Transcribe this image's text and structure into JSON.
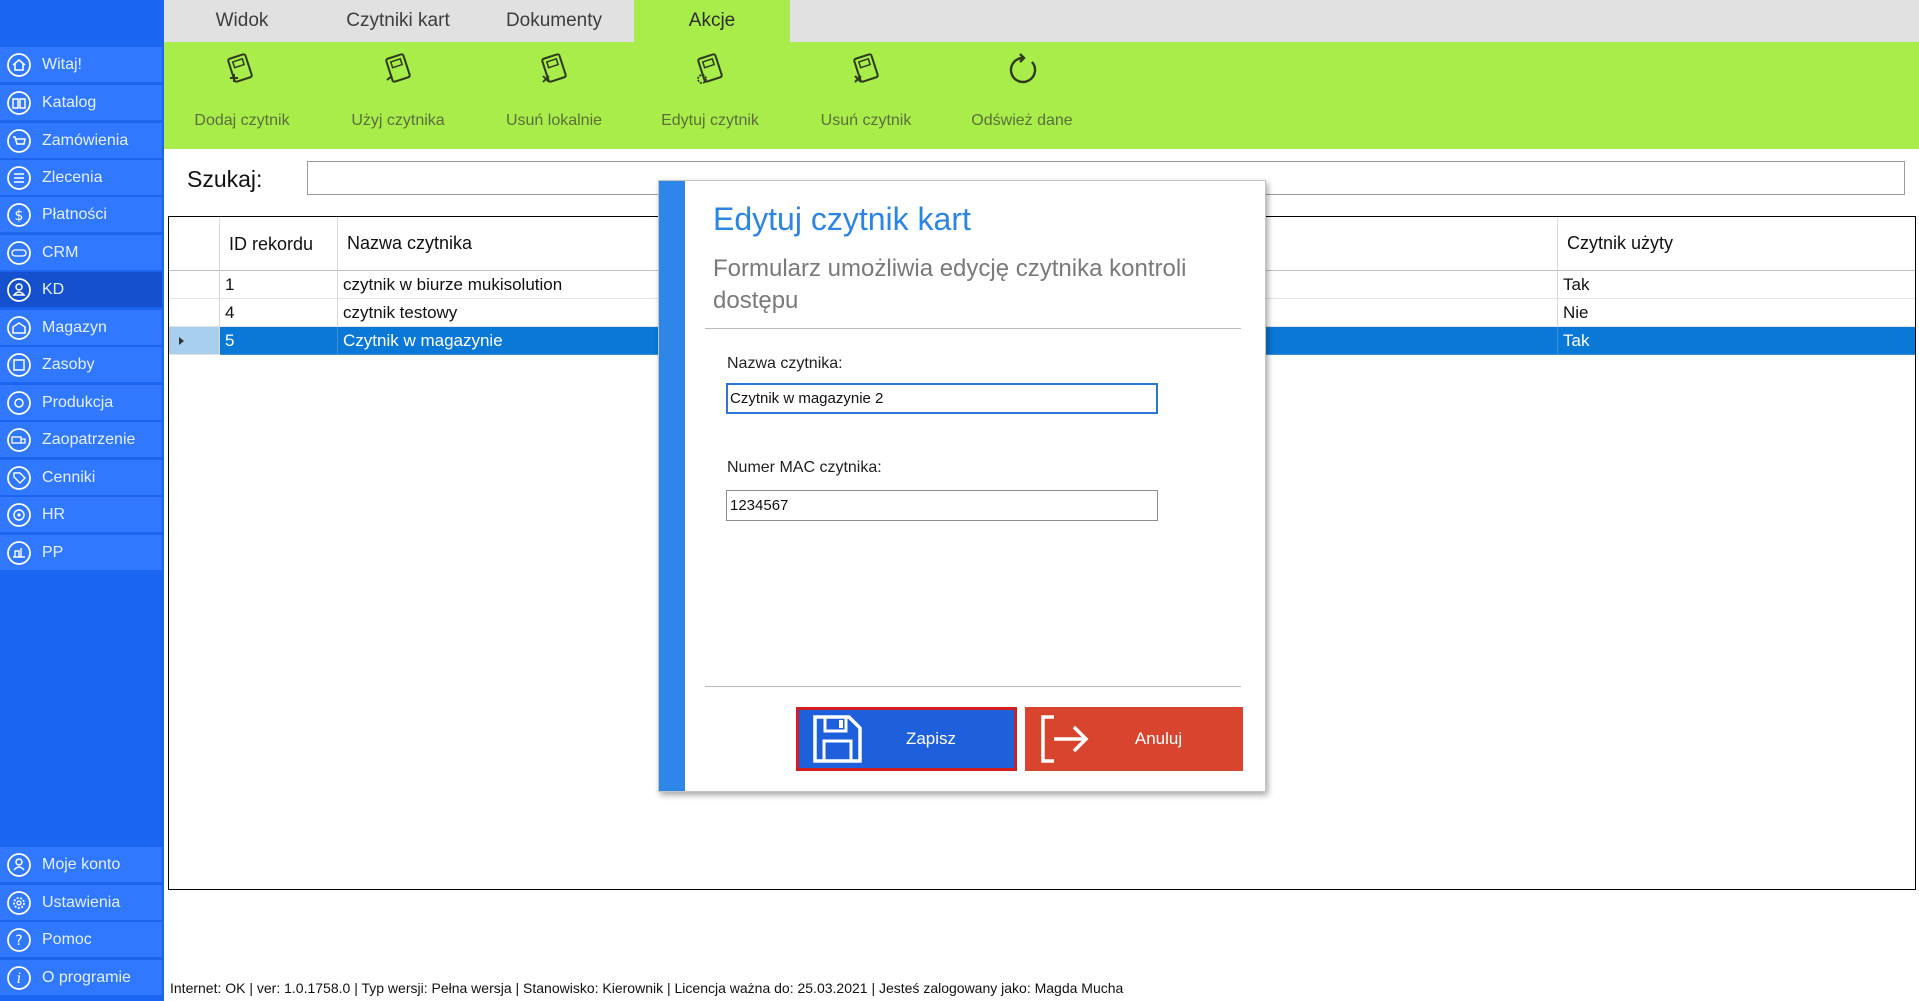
{
  "sidebar": {
    "items": [
      {
        "label": "Witaj!",
        "icon": "home-icon"
      },
      {
        "label": "Katalog",
        "icon": "book-icon"
      },
      {
        "label": "Zamówienia",
        "icon": "cart-icon"
      },
      {
        "label": "Zlecenia",
        "icon": "list-icon"
      },
      {
        "label": "Płatności",
        "icon": "dollar-icon"
      },
      {
        "label": "CRM",
        "icon": "crm-icon"
      },
      {
        "label": "KD",
        "icon": "user-badge-icon"
      },
      {
        "label": "Magazyn",
        "icon": "warehouse-icon"
      },
      {
        "label": "Zasoby",
        "icon": "resources-icon"
      },
      {
        "label": "Produkcja",
        "icon": "production-icon"
      },
      {
        "label": "Zaopatrzenie",
        "icon": "truck-icon"
      },
      {
        "label": "Cenniki",
        "icon": "tag-icon"
      },
      {
        "label": "HR",
        "icon": "hr-icon"
      },
      {
        "label": "PP",
        "icon": "pp-icon"
      }
    ],
    "bottom_items": [
      {
        "label": "Moje konto",
        "icon": "account-icon"
      },
      {
        "label": "Ustawienia",
        "icon": "settings-icon"
      },
      {
        "label": "Pomoc",
        "icon": "help-icon"
      },
      {
        "label": "O programie",
        "icon": "info-icon"
      }
    ],
    "active": "KD"
  },
  "tabs": [
    "Widok",
    "Czytniki kart",
    "Dokumenty",
    "Akcje"
  ],
  "active_tab": "Akcje",
  "ribbon": {
    "buttons": [
      {
        "label": "Dodaj czytnik",
        "icon": "add-reader-icon"
      },
      {
        "label": "Użyj czytnika",
        "icon": "use-reader-icon"
      },
      {
        "label": "Usuń lokalnie",
        "icon": "remove-local-icon"
      },
      {
        "label": "Edytuj czytnik",
        "icon": "edit-reader-icon"
      },
      {
        "label": "Usuń czytnik",
        "icon": "delete-reader-icon"
      },
      {
        "label": "Odśwież dane",
        "icon": "refresh-icon"
      }
    ]
  },
  "search": {
    "label": "Szukaj:",
    "value": ""
  },
  "table": {
    "headers": [
      "ID rekordu",
      "Nazwa czytnika",
      "Czytnik użyty"
    ],
    "rows": [
      {
        "id": "1",
        "name": "czytnik w biurze mukisolution",
        "used": "Tak"
      },
      {
        "id": "4",
        "name": "czytnik testowy",
        "used": "Nie"
      },
      {
        "id": "5",
        "name": "Czytnik w magazynie",
        "used": "Tak"
      }
    ],
    "selected_row": 2
  },
  "dialog": {
    "title": "Edytuj czytnik kart",
    "subtitle": "Formularz umożliwia edycję czytnika kontroli dostępu",
    "name_label": "Nazwa czytnika:",
    "name_value": "Czytnik w magazynie 2",
    "mac_label": "Numer MAC czytnika:",
    "mac_value": "1234567",
    "save_label": "Zapisz",
    "cancel_label": "Anuluj"
  },
  "status": "Internet: OK  |  ver: 1.0.1758.0  |  Typ wersji: Pełna wersja  |  Stanowisko: Kierownik  |  Licencja ważna do: 25.03.2021  |  Jesteś zalogowany jako: Magda Mucha",
  "colors": {
    "sidebar": "#1b66f0",
    "sidebar_item": "#2f78ff",
    "ribbon": "#a9ed4b",
    "accent_blue": "#2e86e8",
    "selection": "#0a78d7",
    "cancel_red": "#d8442e",
    "save_blue": "#1e5fdc"
  }
}
